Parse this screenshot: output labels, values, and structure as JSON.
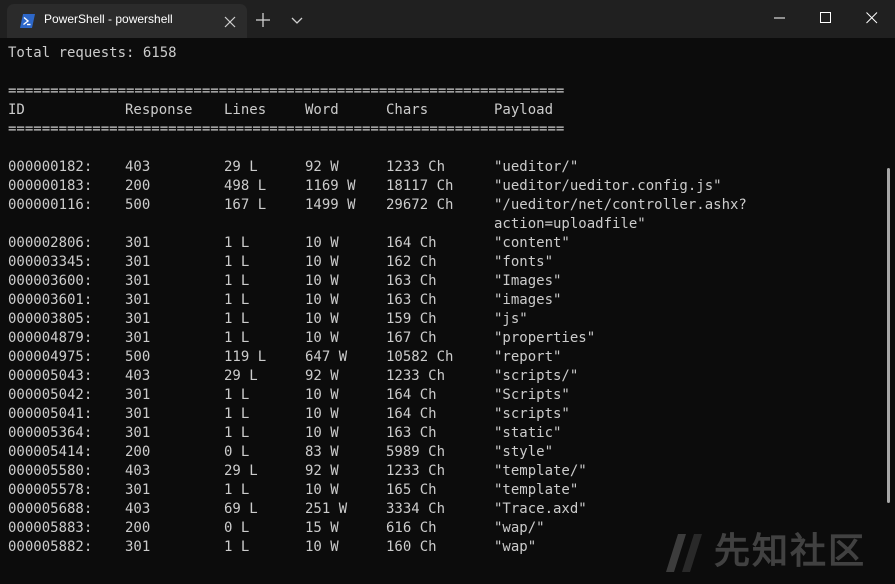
{
  "window": {
    "tab_title": "PowerShell - powershell",
    "icons": [
      "powershell-icon",
      "close-icon",
      "plus-icon",
      "chevron-down-icon",
      "minimize-icon",
      "maximize-icon",
      "close-icon"
    ]
  },
  "terminal": {
    "total_line": "Total requests: 6158",
    "separator": "==================================================================",
    "headers": {
      "id": "ID",
      "response": "Response",
      "lines": "Lines",
      "word": "Word",
      "chars": "Chars",
      "payload": "Payload"
    },
    "rows": [
      {
        "id": "000000182:",
        "response": "403",
        "lines": "29 L",
        "word": "92 W",
        "chars": "1233 Ch",
        "payload": "\"ueditor/\""
      },
      {
        "id": "000000183:",
        "response": "200",
        "lines": "498 L",
        "word": "1169 W",
        "chars": "18117 Ch",
        "payload": "\"ueditor/ueditor.config.js\""
      },
      {
        "id": "000000116:",
        "response": "500",
        "lines": "167 L",
        "word": "1499 W",
        "chars": "29672 Ch",
        "payload": "\"/ueditor/net/controller.ashx?"
      },
      {
        "id": "",
        "response": "",
        "lines": "",
        "word": "",
        "chars": "",
        "payload": "action=uploadfile\""
      },
      {
        "id": "000002806:",
        "response": "301",
        "lines": "1 L",
        "word": "10 W",
        "chars": "164 Ch",
        "payload": "\"content\""
      },
      {
        "id": "000003345:",
        "response": "301",
        "lines": "1 L",
        "word": "10 W",
        "chars": "162 Ch",
        "payload": "\"fonts\""
      },
      {
        "id": "000003600:",
        "response": "301",
        "lines": "1 L",
        "word": "10 W",
        "chars": "163 Ch",
        "payload": "\"Images\""
      },
      {
        "id": "000003601:",
        "response": "301",
        "lines": "1 L",
        "word": "10 W",
        "chars": "163 Ch",
        "payload": "\"images\""
      },
      {
        "id": "000003805:",
        "response": "301",
        "lines": "1 L",
        "word": "10 W",
        "chars": "159 Ch",
        "payload": "\"js\""
      },
      {
        "id": "000004879:",
        "response": "301",
        "lines": "1 L",
        "word": "10 W",
        "chars": "167 Ch",
        "payload": "\"properties\""
      },
      {
        "id": "000004975:",
        "response": "500",
        "lines": "119 L",
        "word": "647 W",
        "chars": "10582 Ch",
        "payload": "\"report\""
      },
      {
        "id": "000005043:",
        "response": "403",
        "lines": "29 L",
        "word": "92 W",
        "chars": "1233 Ch",
        "payload": "\"scripts/\""
      },
      {
        "id": "000005042:",
        "response": "301",
        "lines": "1 L",
        "word": "10 W",
        "chars": "164 Ch",
        "payload": "\"Scripts\""
      },
      {
        "id": "000005041:",
        "response": "301",
        "lines": "1 L",
        "word": "10 W",
        "chars": "164 Ch",
        "payload": "\"scripts\""
      },
      {
        "id": "000005364:",
        "response": "301",
        "lines": "1 L",
        "word": "10 W",
        "chars": "163 Ch",
        "payload": "\"static\""
      },
      {
        "id": "000005414:",
        "response": "200",
        "lines": "0 L",
        "word": "83 W",
        "chars": "5989 Ch",
        "payload": "\"style\""
      },
      {
        "id": "000005580:",
        "response": "403",
        "lines": "29 L",
        "word": "92 W",
        "chars": "1233 Ch",
        "payload": "\"template/\""
      },
      {
        "id": "000005578:",
        "response": "301",
        "lines": "1 L",
        "word": "10 W",
        "chars": "165 Ch",
        "payload": "\"template\""
      },
      {
        "id": "000005688:",
        "response": "403",
        "lines": "69 L",
        "word": "251 W",
        "chars": "3334 Ch",
        "payload": "\"Trace.axd\""
      },
      {
        "id": "000005883:",
        "response": "200",
        "lines": "0 L",
        "word": "15 W",
        "chars": "616 Ch",
        "payload": "\"wap/\""
      },
      {
        "id": "000005882:",
        "response": "301",
        "lines": "1 L",
        "word": "10 W",
        "chars": "160 Ch",
        "payload": "\"wap\""
      }
    ]
  },
  "watermark": {
    "text": "先知社区"
  }
}
